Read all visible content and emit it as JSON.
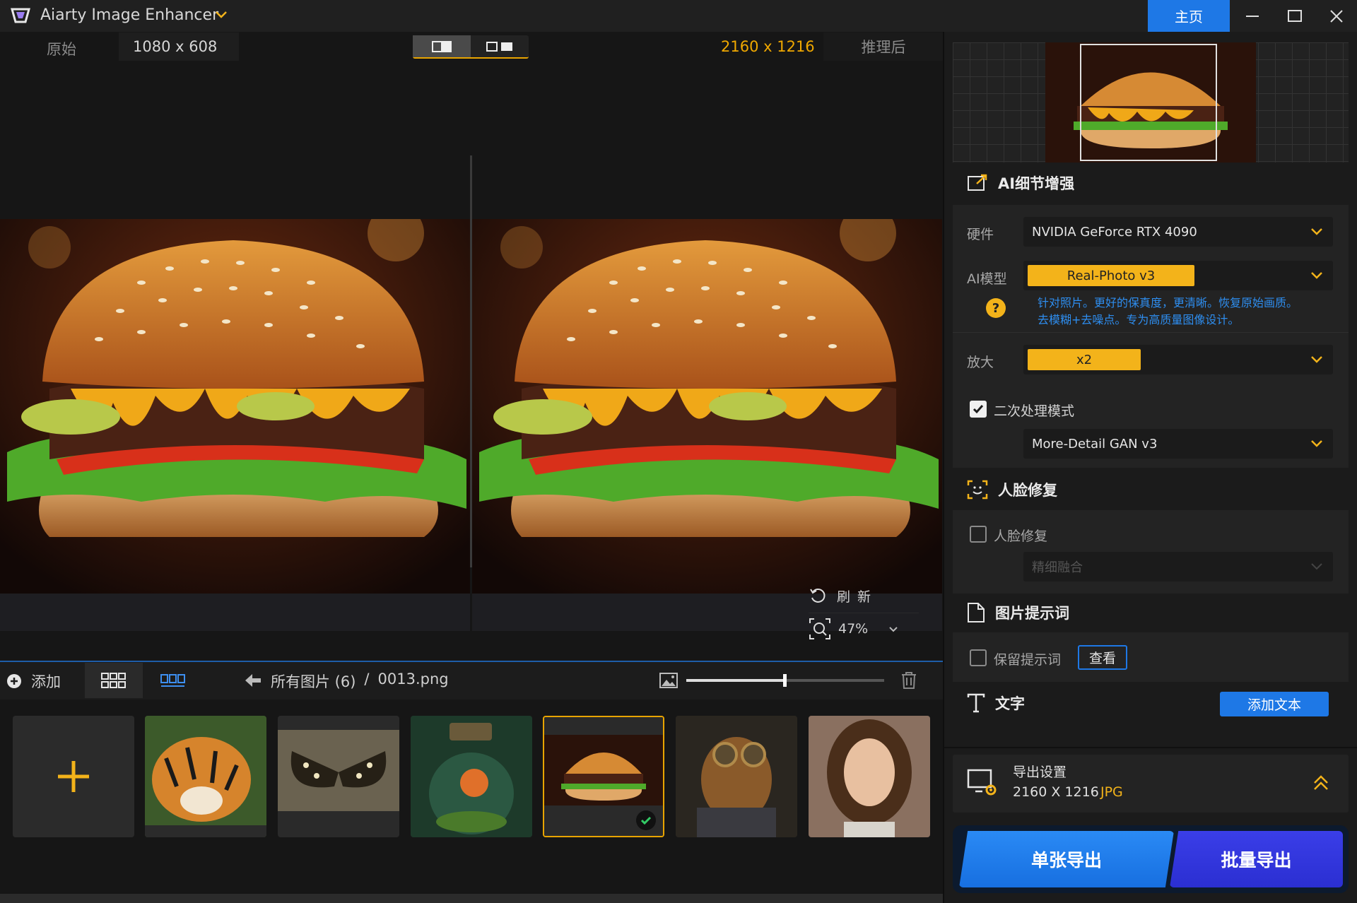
{
  "titlebar": {
    "app_title": "Aiarty Image Enhancer",
    "home_tab": "主页",
    "icons": [
      "app-logo-icon",
      "chevron-down-icon",
      "minimize-icon",
      "maximize-icon",
      "close-icon"
    ]
  },
  "preview": {
    "original_label": "原始",
    "original_size": "1080 x 608",
    "result_size": "2160 x 1216",
    "after_label": "推理后",
    "refresh_label": "刷新",
    "zoom": "47%"
  },
  "gallery": {
    "add_label": "添加",
    "breadcrumb_folder": "所有图片 (6)",
    "breadcrumb_sep": "/",
    "breadcrumb_file": "0013.png",
    "thumbnail_slider": 0.5,
    "thumbnails": [
      "tiger",
      "butterfly",
      "terrarium-jar",
      "burger",
      "steampunk-dog",
      "portrait-girl"
    ],
    "selected": "burger"
  },
  "panel": {
    "ai_section": {
      "title": "AI细节增强",
      "hardware_label": "硬件",
      "hardware_value": "NVIDIA GeForce RTX 4090",
      "model_label": "AI模型",
      "model_value": "Real-Photo  v3",
      "help_glyph": "?",
      "model_desc_1": "针对照片。更好的保真度，更清晰。恢复原始画质。",
      "model_desc_2": "去模糊+去噪点。专为高质量图像设计。",
      "scale_label": "放大",
      "scale_value": "x2",
      "second_pass_label": "二次处理模式",
      "second_pass_checked": true,
      "second_model_value": "More-Detail GAN  v3"
    },
    "face_section": {
      "title": "人脸修复",
      "checkbox_label": "人脸修复",
      "checked": false,
      "mode_value": "精细融合"
    },
    "prompt_section": {
      "title": "图片提示词",
      "keep_label": "保留提示词",
      "checked": false,
      "view_button": "查看"
    },
    "text_section": {
      "title": "文字",
      "add_button": "添加文本"
    },
    "export": {
      "title": "导出设置",
      "size": "2160 X 1216",
      "format": "JPG",
      "single_button": "单张导出",
      "batch_button": "批量导出"
    }
  },
  "colors": {
    "accent_gold": "#f3b31a",
    "accent_blue": "#1e78e6",
    "batch_blue": "#2b2fd2",
    "background": "#161616"
  }
}
